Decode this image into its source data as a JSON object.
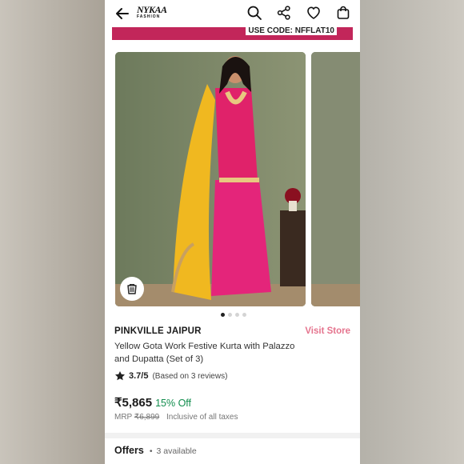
{
  "header": {
    "logo_top": "NYKAA",
    "logo_bottom": "FASHION"
  },
  "banner": {
    "code_text": "USE CODE: NFFLAT10"
  },
  "gallery": {
    "active_index": 0,
    "dot_count": 4
  },
  "product": {
    "brand": "PINKVILLE JAIPUR",
    "visit_store": "Visit Store",
    "title": "Yellow Gota Work Festive Kurta with Palazzo and Dupatta (Set of 3)",
    "rating": "3.7/5",
    "reviews": "(Based on 3 reviews)",
    "price": "₹5,865",
    "discount": "15% Off",
    "mrp_label": "MRP",
    "mrp_value": "₹6,899",
    "tax_note": "Inclusive of all taxes"
  },
  "offers": {
    "label": "Offers",
    "separator": "•",
    "count": "3 available"
  },
  "colors": {
    "accent_pink": "#e5748e",
    "banner": "#c2265a",
    "discount_green": "#118d4d"
  }
}
